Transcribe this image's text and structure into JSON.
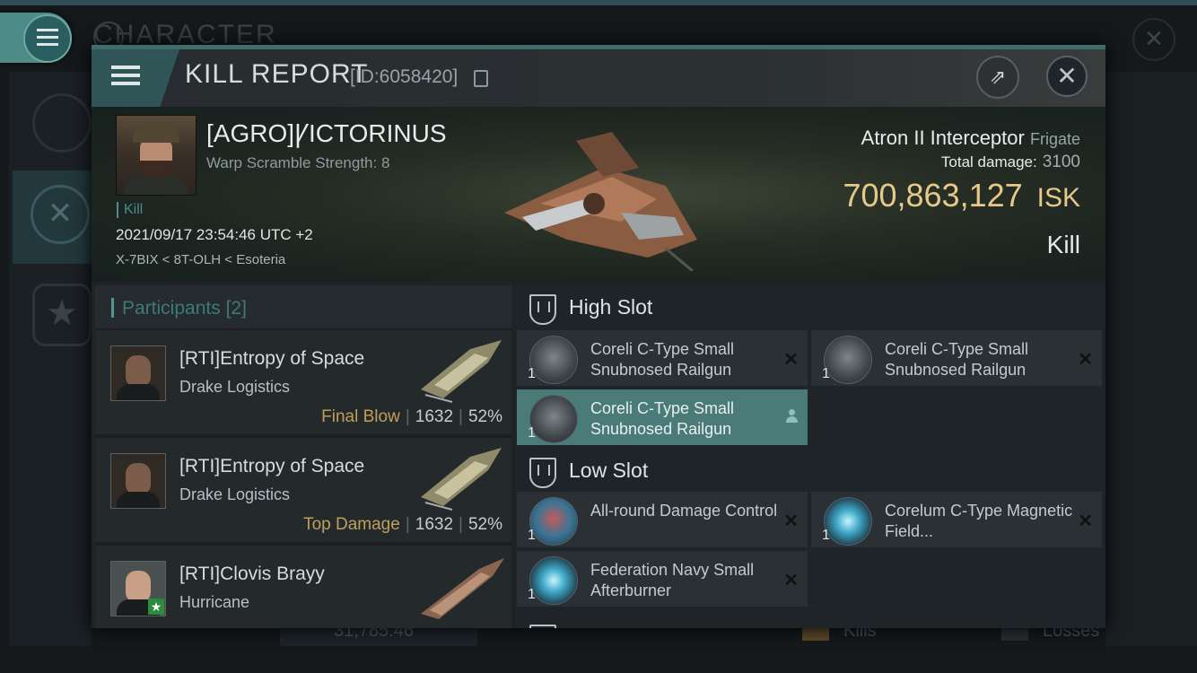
{
  "background": {
    "title": "CHARACTER",
    "isk_value": "31,785.46",
    "kills_label": "Kills",
    "losses_label": "Losses"
  },
  "header": {
    "title": "KILL REPORT",
    "id": "[ID:6058420]"
  },
  "victim": {
    "name": "[AGRO]ꝨICTORINUS",
    "warp_scramble": "Warp Scramble Strength: 8",
    "type_tag": "Kill",
    "datetime": "2021/09/17 23:54:46 UTC +2",
    "location": "X-7BIX < 8T-OLH < Esoteria",
    "ship_name": "Atron II Interceptor",
    "ship_class": "Frigate",
    "total_damage_label": "Total damage:",
    "total_damage": "3100",
    "isk_value": "700,863,127",
    "isk_unit": "ISK",
    "result": "Kill"
  },
  "participants": {
    "title": "Participants",
    "count": "[2]",
    "rows": [
      {
        "name": "[RTI]Entropy of Space",
        "ship": "Drake Logistics",
        "label": "Final Blow",
        "damage": "1632",
        "percent": "52%"
      },
      {
        "name": "[RTI]Entropy of Space",
        "ship": "Drake Logistics",
        "label": "Top Damage",
        "damage": "1632",
        "percent": "52%"
      },
      {
        "name": "[RTI]Clovis Brayy",
        "ship": "Hurricane"
      }
    ]
  },
  "fitting": {
    "high_slot_title": "High Slot",
    "low_slot_title": "Low Slot",
    "high": [
      {
        "qty": "1",
        "name": "Coreli C-Type Small Snubnosed Railgun"
      },
      {
        "qty": "1",
        "name": "Coreli C-Type Small Snubnosed Railgun"
      },
      {
        "qty": "1",
        "name": "Coreli C-Type Small Snubnosed Railgun"
      }
    ],
    "low": [
      {
        "qty": "1",
        "name": "All-round Damage Control"
      },
      {
        "qty": "1",
        "name": "Corelum C-Type Magnetic Field..."
      },
      {
        "qty": "1",
        "name": "Federation Navy Small Afterburner"
      }
    ]
  },
  "colors": {
    "accent": "#4d8b86",
    "isk_gold": "#e6c98a",
    "final_blow": "#bf9f5a"
  }
}
